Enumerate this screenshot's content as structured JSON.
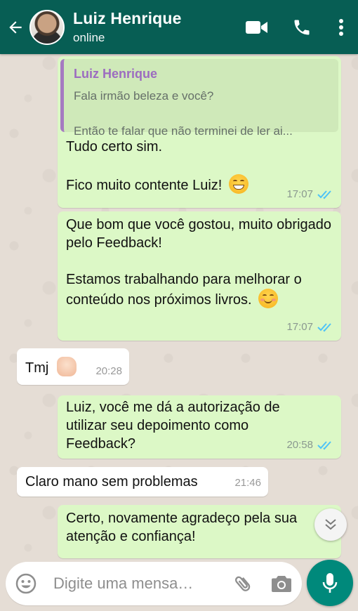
{
  "header": {
    "contact_name": "Luiz Henrique",
    "status": "online",
    "icons": [
      "back-arrow-icon",
      "video-call-icon",
      "phone-icon",
      "more-options-icon"
    ],
    "bg_color": "#075e54"
  },
  "messages": [
    {
      "direction": "outgoing",
      "quote": {
        "author": "Luiz Henrique",
        "line1": "Fala irmão beleza e você?",
        "line2": "Então te falar que não terminei de ler ai..."
      },
      "text": "Tudo certo sim.\n\nFico muito contente Luiz!",
      "emoji": "grinning-face",
      "time": "17:07",
      "read": true
    },
    {
      "direction": "outgoing",
      "text": "Que bom que você gostou, muito obrigado pelo Feedback!\n\nEstamos trabalhando para melhorar o conteúdo nos próximos livros.",
      "emoji": "smiling-face",
      "time": "17:07",
      "read": true
    },
    {
      "direction": "incoming",
      "text": "Tmj",
      "emoji": "fist-bump",
      "time": "20:28"
    },
    {
      "direction": "outgoing",
      "text": "Luiz, você me dá a autorização de utilizar seu depoimento como Feedback?",
      "time": "20:58",
      "read": true
    },
    {
      "direction": "incoming",
      "text": "Claro mano sem problemas",
      "time": "21:46"
    },
    {
      "direction": "outgoing",
      "text": "Certo, novamente agradeço pela sua atenção e confiança!"
    }
  ],
  "composer": {
    "placeholder": "Digite uma mensa…",
    "icons": [
      "emoji-icon",
      "attach-icon",
      "camera-icon",
      "mic-icon"
    ]
  },
  "colors": {
    "outgoing_bubble": "#dcf8c6",
    "incoming_bubble": "#ffffff",
    "read_tick": "#4fc3f7",
    "mic_button": "#00897b"
  }
}
